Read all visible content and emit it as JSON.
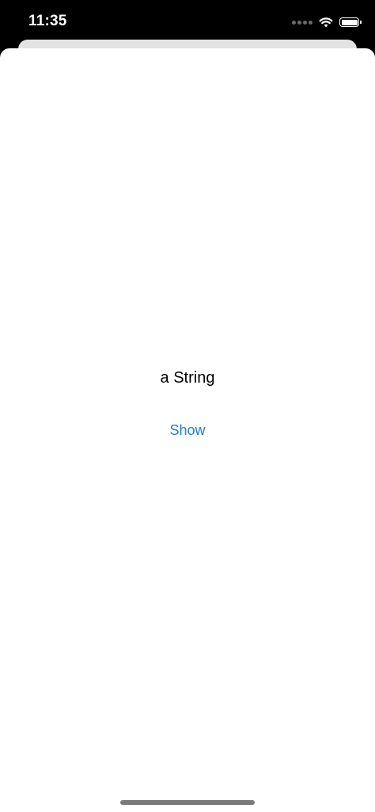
{
  "status_bar": {
    "time": "11:35",
    "icons": [
      "signal-dots-icon",
      "wifi-icon",
      "battery-icon"
    ]
  },
  "main": {
    "text": "a String",
    "show_button_label": "Show"
  },
  "colors": {
    "accent": "#1a80d9",
    "background": "#ffffff",
    "status_bar_background": "#000000",
    "back_sheet": "#e3e3e3"
  }
}
